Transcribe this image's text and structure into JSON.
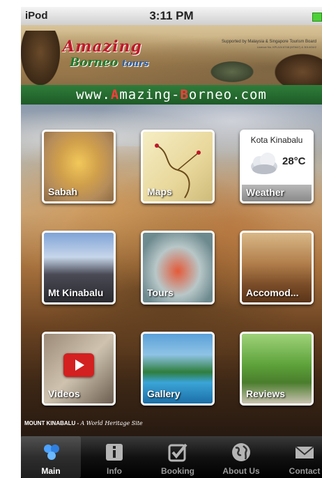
{
  "status_bar": {
    "carrier": "iPod",
    "time": "3:11 PM"
  },
  "header": {
    "logo_line1": "Amazing",
    "logo_line2": "Borneo",
    "logo_line2_sub": "tours",
    "support_text": "Supported by Malaysia & Singapore Tourism Board",
    "licence_text": "Licence No. KPL/LN 6748 (MTA67) & 3014/04/2",
    "url_part1": "www.",
    "url_a": "A",
    "url_part2": "mazing-",
    "url_b": "B",
    "url_part3": "orneo.com"
  },
  "tiles": {
    "sabah": "Sabah",
    "maps": "Maps",
    "weather": {
      "label": "Weather",
      "city": "Kota Kinabalu",
      "temperature": "28°C",
      "icon": "cloud-icon"
    },
    "mt_kinabalu": "Mt Kinabalu",
    "tours": "Tours",
    "accommodation": "Accomod...",
    "videos": "Videos",
    "gallery": "Gallery",
    "reviews": "Reviews"
  },
  "caption": {
    "title": "MOUNT KINABALU -",
    "subtitle": "A World Heritage Site"
  },
  "tabbar": {
    "items": [
      {
        "label": "Main",
        "icon": "hexagon-cluster-icon",
        "active": true
      },
      {
        "label": "Info",
        "icon": "info-icon",
        "active": false
      },
      {
        "label": "Booking",
        "icon": "checkmark-icon",
        "active": false
      },
      {
        "label": "About Us",
        "icon": "globe-icon",
        "active": false
      },
      {
        "label": "Contact",
        "icon": "envelope-icon",
        "active": false
      }
    ]
  },
  "colors": {
    "url_bar": "#2f7d3a",
    "logo_red": "#c0182a",
    "tab_active": "#ffffff",
    "tab_inactive": "#9a9a9a",
    "play_red": "#d32020"
  }
}
